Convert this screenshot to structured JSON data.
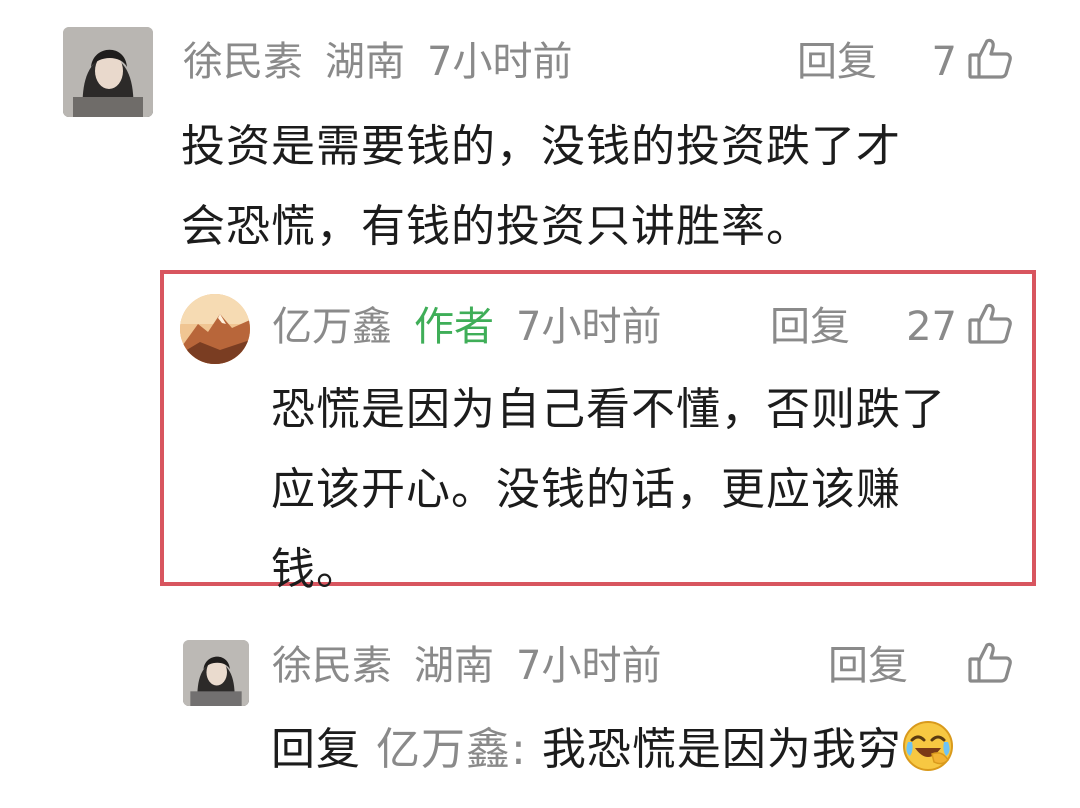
{
  "comments": [
    {
      "username": "徐民素",
      "location": "湖南",
      "time": "7小时前",
      "reply_label": "回复",
      "likes": "7",
      "lines": [
        "投资是需要钱的，没钱的投资跌了才",
        "会恐慌，有钱的投资只讲胜率。"
      ]
    },
    {
      "username": "亿万鑫",
      "author_tag": "作者",
      "time": "7小时前",
      "reply_label": "回复",
      "likes": "27",
      "lines": [
        "恐慌是因为自己看不懂，否则跌了",
        "应该开心。没钱的话，更应该赚",
        "钱。"
      ]
    },
    {
      "username": "徐民素",
      "location": "湖南",
      "time": "7小时前",
      "reply_label": "回复",
      "reply_prefix": "回复",
      "reply_target": "亿万鑫:",
      "reply_body": "我恐慌是因为我穷"
    }
  ],
  "icons": {
    "thumb": "thumb-up-icon",
    "emoji": "laugh-cry-emoji-icon"
  },
  "colors": {
    "meta": "#8a8a8a",
    "author_tag": "#3fae58",
    "highlight": "#d8555f",
    "text": "#1c1c1c"
  }
}
